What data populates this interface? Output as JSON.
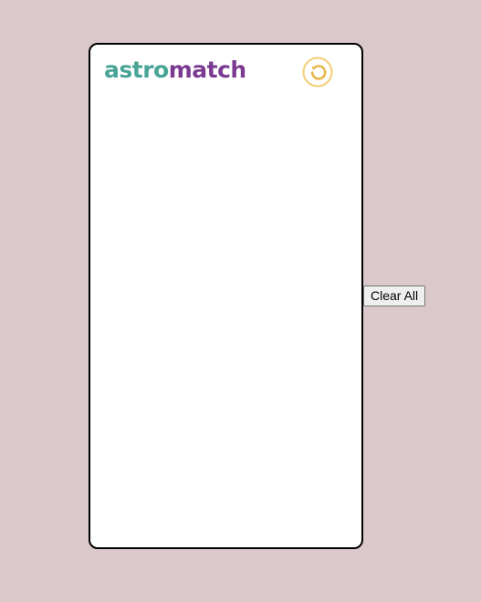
{
  "app": {
    "logo_part_a": "astro",
    "logo_part_b": "match"
  },
  "header": {
    "reset_icon": "refresh-icon"
  },
  "controls": {
    "clear_all_label": "Clear All"
  },
  "colors": {
    "background": "#dbc8ca",
    "logo_teal": "#49a496",
    "logo_purple": "#7b3a92",
    "reset_icon": "#f2cd72"
  }
}
